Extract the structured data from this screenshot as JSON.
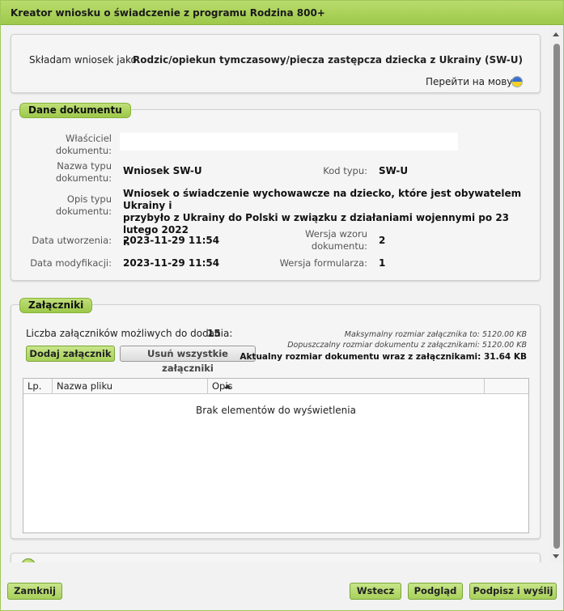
{
  "window": {
    "title": "Kreator wniosku o świadczenie z programu Rodzina 800+"
  },
  "applicant": {
    "label": "Składam wniosek jako:",
    "value": "Rodzic/opiekun tymczasowy/piecza zastępcza dziecka z Ukrainy (SW-U)",
    "switch_language": "Перейти на мову:",
    "flag_icon": "ukraine-flag-icon",
    "flag_colors": [
      "#3a6fd0",
      "#f5d020"
    ]
  },
  "document": {
    "section_title": "Dane dokumentu",
    "owner_label_1": "Właściciel",
    "owner_label_2": "dokumentu:",
    "owner_value": "",
    "type_name_label_1": "Nazwa typu",
    "type_name_label_2": "dokumentu:",
    "type_name_value": "Wniosek SW-U",
    "type_code_label": "Kod typu:",
    "type_code_value": "SW-U",
    "description_label_1": "Opis typu",
    "description_label_2": "dokumentu:",
    "description_line_1": "Wniosek o świadczenie wychowawcze na dziecko, które jest obywatelem Ukrainy i",
    "description_line_2": "przybyło z Ukrainy do Polski w związku z działaniami wojennymi po 23 lutego 2022",
    "description_line_3": "r.",
    "created_label": "Data utworzenia:",
    "created_value": "2023-11-29 11:54",
    "template_version_label_1": "Wersja wzoru",
    "template_version_label_2": "dokumentu:",
    "template_version_value": "2",
    "modified_label": "Data modyfikacji:",
    "modified_value": "2023-11-29 11:54",
    "form_version_label": "Wersja formularza:",
    "form_version_value": "1"
  },
  "attachments": {
    "section_title": "Załączniki",
    "count_label": "Liczba załączników możliwych do dodania:",
    "count_value": "15",
    "add_button": "Dodaj załącznik",
    "remove_all_button": "Usuń wszystkie załączniki",
    "max_size": "Maksymalny rozmiar załącznika to: 5120.00 KB",
    "allowed_size": "Dopuszczalny rozmiar dokumentu z załącznikami: 5120.00 KB",
    "current_size": "Aktualny rozmiar dokumentu wraz z załącznikami: 31.64 KB",
    "columns": [
      "Lp.",
      "Nazwa pliku",
      "Opis"
    ],
    "empty_message": "Brak elementów do wyświetlenia"
  },
  "footer": {
    "close_button": "Zamknij",
    "back_button": "Wstecz",
    "preview_button": "Podgląd",
    "sign_send_button": "Podpisz i wyślij"
  },
  "colors": {
    "accent": "#9dc94a",
    "accent_border": "#7aa63a",
    "panel_bg": "#f5f5f5"
  }
}
